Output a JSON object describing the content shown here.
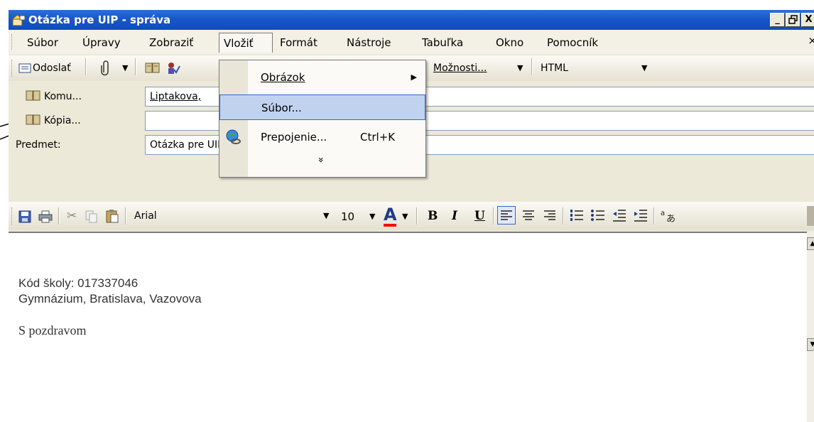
{
  "window": {
    "title": "Otázka pre UIP - správa",
    "controls": {
      "minimize": "_",
      "restore": "🗗",
      "close": "X"
    }
  },
  "menubar": {
    "items": [
      "Súbor",
      "Úpravy",
      "Zobraziť",
      "Vložiť",
      "Formát",
      "Nástroje",
      "Tabuľka",
      "Okno",
      "Pomocník"
    ],
    "open_item": "Vložiť",
    "close_glyph": "×"
  },
  "toolbar1": {
    "send_label": "Odoslať",
    "options_label": "Možnosti...",
    "format_value": "HTML"
  },
  "insert_menu": {
    "items": [
      {
        "label": "Obrázok",
        "shortcut": "",
        "submenu": true
      },
      {
        "label": "Súbor...",
        "shortcut": "",
        "highlighted": true
      },
      {
        "label": "Prepojenie...",
        "shortcut": "Ctrl+K"
      }
    ],
    "expand_glyph": "»"
  },
  "fields": {
    "to": {
      "label": "Komu...",
      "value": "Liptakova,"
    },
    "cc": {
      "label": "Kópia...",
      "value": ""
    },
    "subject": {
      "label": "Predmet:",
      "value": "Otázka pre UIP"
    }
  },
  "toolbar2": {
    "font": "Arial",
    "size": "10",
    "bold": "B",
    "italic": "I",
    "underline": "U",
    "text_color_letter": "A",
    "font_color": "#ff0000"
  },
  "message_body": {
    "line1": "Kód školy: 017337046",
    "line2": "Gymnázium, Bratislava, Vazovova",
    "line3": "S pozdravom"
  },
  "colors": {
    "titlebar": "#1957c8",
    "menu_highlight": "#c1d2ee",
    "highlight_border": "#316ac5"
  }
}
